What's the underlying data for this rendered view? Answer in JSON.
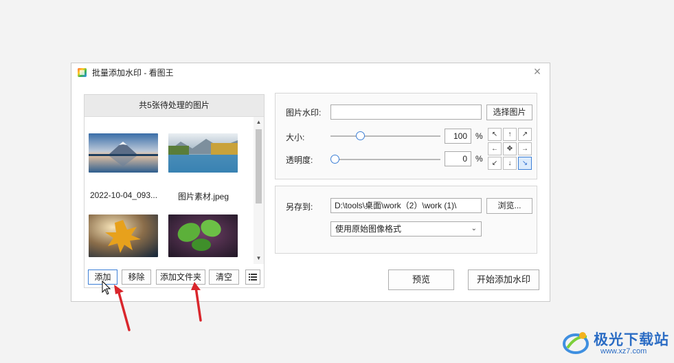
{
  "dialog": {
    "title": "批量添加水印 - 看图王",
    "close_icon": "close-icon"
  },
  "file_list": {
    "header": "共5张待处理的图片",
    "items": [
      {
        "name": "2022-10-04_093...",
        "thumb": "mountain-lake"
      },
      {
        "name": "图片素材.jpeg",
        "thumb": "autumn-lake"
      },
      {
        "name": "",
        "thumb": "maple-leaf"
      },
      {
        "name": "",
        "thumb": "green-leaves"
      }
    ]
  },
  "list_buttons": {
    "add": "添加",
    "remove": "移除",
    "add_folder": "添加文件夹",
    "clear": "清空",
    "view_icon": "list-view-icon"
  },
  "watermark_settings": {
    "image_label": "图片水印:",
    "image_value": "",
    "choose_button": "选择图片",
    "size_label": "大小:",
    "size_value": "100",
    "size_unit": "%",
    "size_slider_fraction": 0.25,
    "opacity_label": "透明度:",
    "opacity_value": "0",
    "opacity_unit": "%",
    "opacity_slider_fraction": 0.0,
    "positions": [
      "↖",
      "↑",
      "↗",
      "←",
      "✥",
      "→",
      "↙",
      "↓",
      "↘"
    ],
    "selected_position": "bottom-right"
  },
  "save_settings": {
    "save_label": "另存到:",
    "save_path": "D:\\tools\\桌面\\work（2）\\work (1)\\",
    "browse_button": "浏览...",
    "format_select": "使用原始图像格式"
  },
  "actions": {
    "preview": "预览",
    "start": "开始添加水印"
  },
  "site_watermark": {
    "cn_text": "极光下载站",
    "url": "www.xz7.com"
  },
  "colors": {
    "accent": "#3c7fd6",
    "annotation_arrow": "#d9262c",
    "watermark_text": "#2b6cc4"
  }
}
